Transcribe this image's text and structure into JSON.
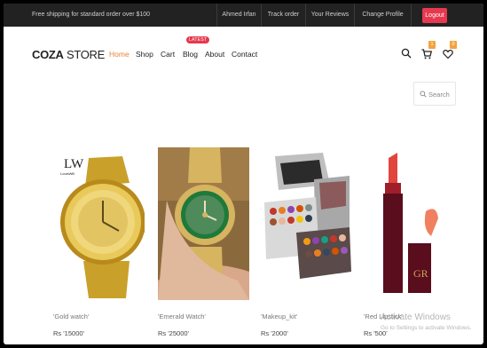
{
  "topbar": {
    "shipping_text": "Free shipping for standard order over $100",
    "links": [
      "Ahmed Irfan",
      "Track order",
      "Your Reviews",
      "Change Profile"
    ],
    "logout_label": "Logout"
  },
  "header": {
    "logo_bold": "COZA",
    "logo_light": " STORE",
    "nav": [
      "Home",
      "Shop",
      "Cart",
      "Blog",
      "About",
      "Contact"
    ],
    "active_nav": "Home",
    "blog_badge": "LATEST",
    "cart_count": "1",
    "wishlist_count": "0"
  },
  "search": {
    "label": "Search"
  },
  "products": [
    {
      "name": "'Gold watch'",
      "price": "Rs '15000'",
      "brand_mark": "LW",
      "brand_text": "LouisWill"
    },
    {
      "name": "'Emerald Watch'",
      "price": "Rs '25000'"
    },
    {
      "name": "'Makeup_kit'",
      "price": "Rs '2000'"
    },
    {
      "name": "'Red Lipstick'",
      "price": "Rs '500'"
    }
  ],
  "watermark": {
    "title": "Activate Windows",
    "subtitle": "Go to Settings to activate Windows."
  },
  "colors": {
    "accent": "#e7813b",
    "logout": "#e6394f",
    "badge": "#f4a340",
    "topbar": "#222222"
  }
}
